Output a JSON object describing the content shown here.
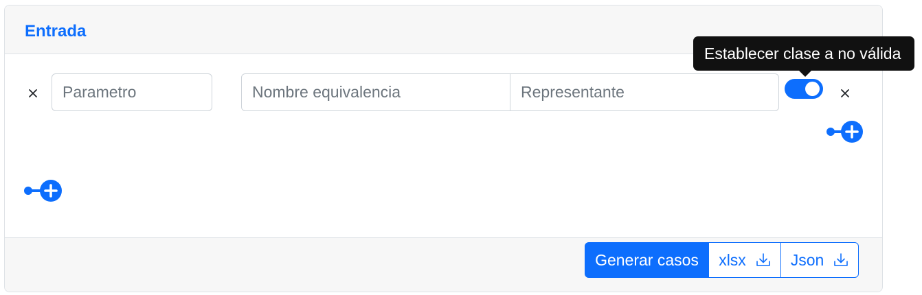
{
  "card": {
    "title": "Entrada"
  },
  "row": {
    "parameter_placeholder": "Parametro",
    "equivalence_name_placeholder": "Nombre equivalencia",
    "representative_placeholder": "Representante",
    "valid_toggle_on": true
  },
  "tooltip": {
    "text": "Establecer clase a no válida"
  },
  "footer": {
    "generate_label": "Generar casos",
    "xlsx_label": "xlsx",
    "json_label": "Json"
  },
  "icons": {
    "remove_parameter": "close-icon",
    "remove_class": "close-icon",
    "add_class": "add-circle-icon",
    "add_parameter": "add-circle-icon",
    "download": "download-icon"
  },
  "colors": {
    "primary": "#0d6efd",
    "header_bg": "#f7f7f7",
    "tooltip_bg": "#111111"
  }
}
